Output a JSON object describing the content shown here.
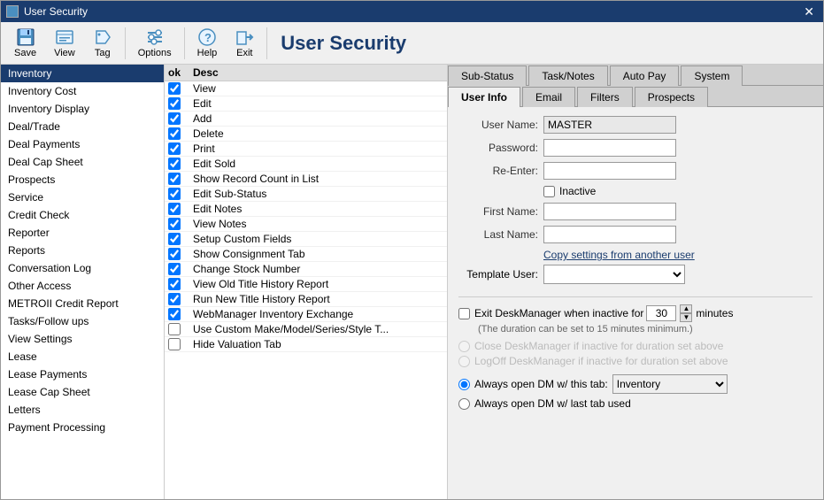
{
  "window": {
    "title": "User Security"
  },
  "toolbar": {
    "save_label": "Save",
    "view_label": "View",
    "tag_label": "Tag",
    "options_label": "Options",
    "help_label": "Help",
    "exit_label": "Exit",
    "app_title": "User Security"
  },
  "sidebar": {
    "items": [
      {
        "label": "Inventory",
        "selected": true
      },
      {
        "label": "Inventory Cost",
        "selected": false
      },
      {
        "label": "Inventory Display",
        "selected": false
      },
      {
        "label": "Deal/Trade",
        "selected": false
      },
      {
        "label": "Deal Payments",
        "selected": false
      },
      {
        "label": "Deal Cap Sheet",
        "selected": false
      },
      {
        "label": "Prospects",
        "selected": false
      },
      {
        "label": "Service",
        "selected": false
      },
      {
        "label": "Credit Check",
        "selected": false
      },
      {
        "label": "Reporter",
        "selected": false
      },
      {
        "label": "Reports",
        "selected": false
      },
      {
        "label": "Conversation Log",
        "selected": false
      },
      {
        "label": "Other Access",
        "selected": false
      },
      {
        "label": "METROII Credit Report",
        "selected": false
      },
      {
        "label": "Tasks/Follow ups",
        "selected": false
      },
      {
        "label": "View Settings",
        "selected": false
      },
      {
        "label": "Lease",
        "selected": false
      },
      {
        "label": "Lease Payments",
        "selected": false
      },
      {
        "label": "Lease Cap Sheet",
        "selected": false
      },
      {
        "label": "Letters",
        "selected": false
      },
      {
        "label": "Payment Processing",
        "selected": false
      }
    ]
  },
  "middle": {
    "col_ok": "ok",
    "col_desc": "Desc",
    "rows": [
      {
        "checked": true,
        "label": "View"
      },
      {
        "checked": true,
        "label": "Edit"
      },
      {
        "checked": true,
        "label": "Add"
      },
      {
        "checked": true,
        "label": "Delete"
      },
      {
        "checked": true,
        "label": "Print"
      },
      {
        "checked": true,
        "label": "Edit Sold"
      },
      {
        "checked": true,
        "label": "Show Record Count in List"
      },
      {
        "checked": true,
        "label": "Edit Sub-Status"
      },
      {
        "checked": true,
        "label": "Edit Notes"
      },
      {
        "checked": true,
        "label": "View Notes"
      },
      {
        "checked": true,
        "label": "Setup Custom Fields"
      },
      {
        "checked": true,
        "label": "Show Consignment Tab"
      },
      {
        "checked": true,
        "label": "Change Stock Number"
      },
      {
        "checked": true,
        "label": "View Old Title History Report"
      },
      {
        "checked": true,
        "label": "Run New Title History Report"
      },
      {
        "checked": true,
        "label": "WebManager Inventory Exchange"
      },
      {
        "checked": false,
        "label": "Use Custom Make/Model/Series/Style T..."
      },
      {
        "checked": false,
        "label": "Hide Valuation Tab"
      }
    ]
  },
  "right": {
    "tabs_row1": [
      {
        "label": "Sub-Status",
        "active": false
      },
      {
        "label": "Task/Notes",
        "active": false
      },
      {
        "label": "Auto Pay",
        "active": false
      },
      {
        "label": "System",
        "active": false
      }
    ],
    "tabs_row2": [
      {
        "label": "User Info",
        "active": true
      },
      {
        "label": "Email",
        "active": false
      },
      {
        "label": "Filters",
        "active": false
      },
      {
        "label": "Prospects",
        "active": false
      }
    ],
    "form": {
      "username_label": "User Name:",
      "username_value": "MASTER",
      "password_label": "Password:",
      "reenter_label": "Re-Enter:",
      "inactive_label": "Inactive",
      "firstname_label": "First Name:",
      "lastname_label": "Last Name:",
      "copy_settings_text": "Copy settings from another user",
      "template_label": "Template User:"
    },
    "inactive_section": {
      "checkbox_label": "Exit DeskManager when inactive for",
      "minutes_value": "30",
      "minutes_label": "minutes",
      "note": "(The duration can be set to 15 minutes minimum.)",
      "radio1": "Close DeskManager if inactive for duration set above",
      "radio2": "LogOff DeskManager if inactive for duration set above"
    },
    "bottom": {
      "radio1_label": "Always open DM w/ this tab:",
      "dropdown_value": "Inventory",
      "radio2_label": "Always open DM w/ last tab used"
    }
  }
}
